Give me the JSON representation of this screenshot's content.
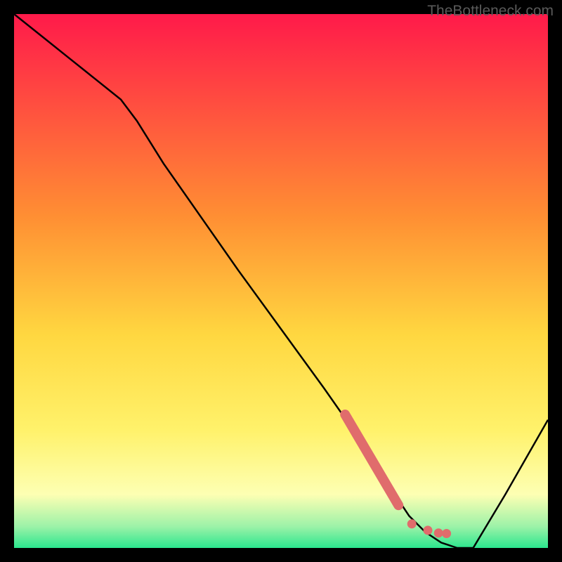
{
  "watermark": "TheBottleneck.com",
  "chart_data": {
    "type": "line",
    "title": "",
    "xlabel": "",
    "ylabel": "",
    "xlim": [
      0,
      100
    ],
    "ylim": [
      0,
      100
    ],
    "background_gradient": {
      "top": "#ff1a4a",
      "mid1": "#ffa533",
      "mid2": "#ffe64d",
      "mid3": "#ffff80",
      "bottom": "#2be68e"
    },
    "series": [
      {
        "name": "bottleneck-curve",
        "x": [
          0,
          5,
          10,
          15,
          20,
          23,
          28,
          35,
          42,
          50,
          58,
          65,
          70,
          72,
          74,
          77,
          80,
          83,
          86,
          92,
          100
        ],
        "y": [
          100,
          96,
          92,
          88,
          84,
          80,
          72,
          62,
          52,
          41,
          30,
          20,
          12,
          9,
          6,
          3,
          1,
          0,
          0,
          10,
          24
        ]
      }
    ],
    "highlight_segment": {
      "name": "highlighted-range",
      "color": "#e06c6c",
      "points": [
        {
          "x": 62,
          "y": 25
        },
        {
          "x": 72,
          "y": 8
        }
      ],
      "dots": [
        {
          "x": 74.5,
          "y": 4.5
        },
        {
          "x": 77.5,
          "y": 3.3
        },
        {
          "x": 79.5,
          "y": 2.8
        },
        {
          "x": 81.0,
          "y": 2.7
        }
      ]
    }
  }
}
